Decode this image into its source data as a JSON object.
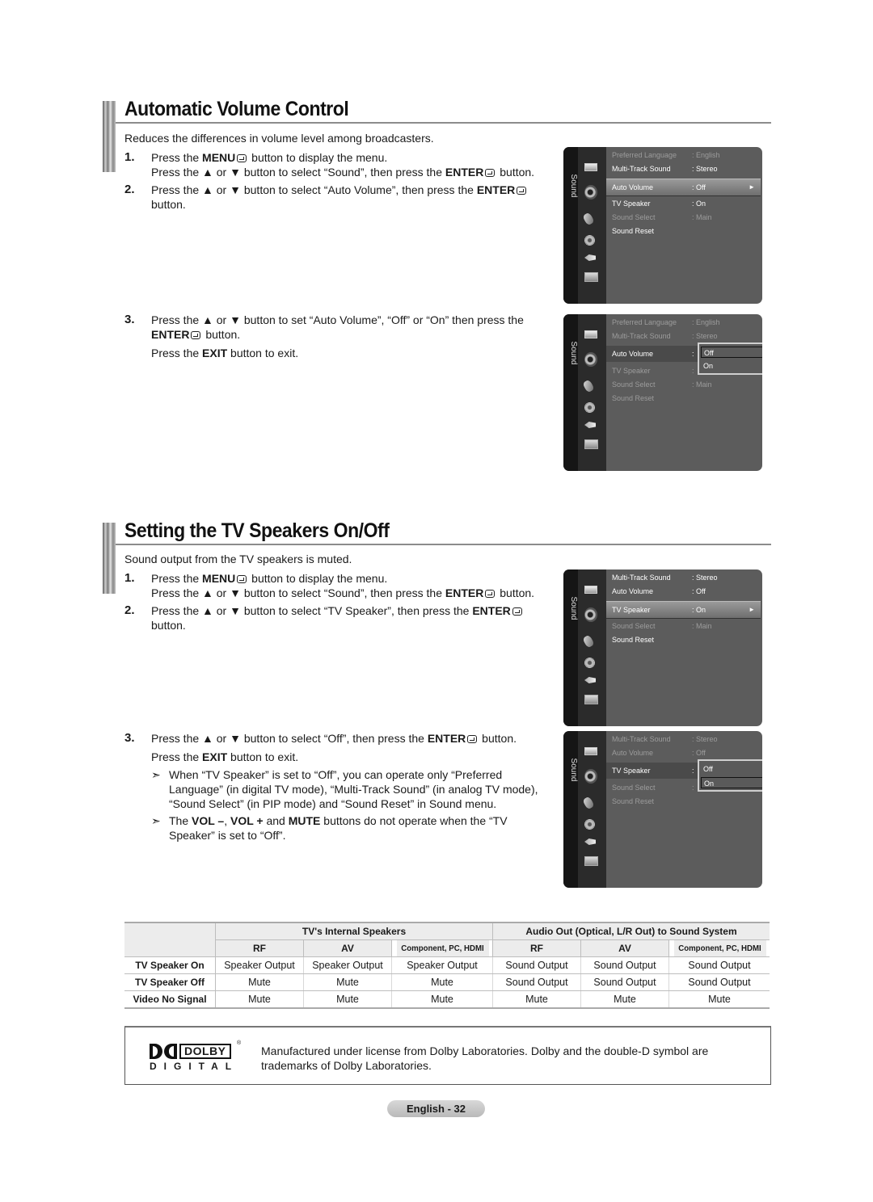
{
  "sections": [
    {
      "title": "Automatic Volume Control",
      "intro": "Reduces the differences in volume level among broadcasters.",
      "steps": [
        {
          "num": "1.",
          "lines": [
            {
              "pre": "Press the ",
              "bold": "MENU",
              "post": " button to display the menu."
            },
            {
              "pre": "Press the ▲ or ▼ button to select “Sound”, then press the ",
              "bold": "ENTER",
              "post": " button."
            }
          ]
        },
        {
          "num": "2.",
          "lines": [
            {
              "pre": "Press the ▲ or ▼ button to select “Auto Volume”, then press the ",
              "bold": "ENTER",
              "post": ""
            },
            {
              "pre": "button.",
              "bold": "",
              "post": ""
            }
          ]
        },
        {
          "num": "3.",
          "lines": [
            {
              "pre": "Press the ▲ or ▼ button to set “Auto Volume”, “Off” or “On” then press the",
              "bold": "",
              "post": ""
            },
            {
              "pre": "",
              "bold": "ENTER",
              "post": " button."
            }
          ],
          "extra": {
            "pre": "Press the ",
            "bold": "EXIT",
            "post": " button to exit."
          }
        }
      ]
    },
    {
      "title": "Setting the TV Speakers On/Off",
      "intro": "Sound output from the TV speakers is muted.",
      "steps": [
        {
          "num": "1.",
          "lines": [
            {
              "pre": "Press the ",
              "bold": "MENU",
              "post": " button to display the menu."
            },
            {
              "pre": "Press the ▲ or ▼ button to select “Sound”, then press the ",
              "bold": "ENTER",
              "post": " button."
            }
          ]
        },
        {
          "num": "2.",
          "lines": [
            {
              "pre": "Press the ▲ or ▼ button to select “TV Speaker”, then press the ",
              "bold": "ENTER",
              "post": ""
            },
            {
              "pre": "button.",
              "bold": "",
              "post": ""
            }
          ]
        },
        {
          "num": "3.",
          "lines": [
            {
              "pre": "Press the ▲ or ▼ button to select “Off”, then press the ",
              "bold": "ENTER",
              "post": " button."
            }
          ],
          "extra": {
            "pre": "Press the ",
            "bold": "EXIT",
            "post": " button to exit."
          }
        }
      ],
      "notes": [
        {
          "arrow": "➣",
          "lines": [
            "When “TV Speaker” is set to “Off”, you can operate only “Preferred",
            "Language” (in digital TV mode), “Multi-Track Sound” (in analog TV mode),",
            "“Sound Select” (in PIP mode) and “Sound Reset” in Sound menu."
          ]
        },
        {
          "arrow": "➣",
          "lines_rich": [
            [
              {
                "t": "The "
              },
              {
                "b": "VOL –"
              },
              {
                "t": ", "
              },
              {
                "b": "VOL +"
              },
              {
                "t": " and "
              },
              {
                "b": "MUTE"
              },
              {
                "t": " buttons do not operate when the “TV"
              }
            ],
            [
              {
                "t": "Speaker” is set to “Off”."
              }
            ]
          ]
        }
      ]
    }
  ],
  "osd": {
    "side_label": "Sound",
    "icons": [
      "picture-icon",
      "sound-icon",
      "channel-icon",
      "setup-icon",
      "input-icon",
      "application-icon"
    ],
    "screens": [
      {
        "rows": [
          {
            "label": "Preferred Language",
            "value": ": English",
            "state": "dim"
          },
          {
            "label": "Multi-Track Sound",
            "value": ": Stereo",
            "state": "normal"
          },
          {
            "label": "Auto Volume",
            "value": ": Off",
            "state": "selected"
          },
          {
            "label": "TV Speaker",
            "value": ": On",
            "state": "normal"
          },
          {
            "label": "Sound Select",
            "value": ": Main",
            "state": "dim"
          },
          {
            "label": "Sound Reset",
            "value": "",
            "state": "normal"
          }
        ]
      },
      {
        "rows": [
          {
            "label": "Preferred Language",
            "value": ": English",
            "state": "dim"
          },
          {
            "label": "Multi-Track Sound",
            "value": ": Stereo",
            "state": "dim"
          },
          {
            "label": "Auto Volume",
            "value": ":",
            "state": "open"
          },
          {
            "label": "TV Speaker",
            "value": ":",
            "state": "dim"
          },
          {
            "label": "Sound Select",
            "value": ": Main",
            "state": "dim"
          },
          {
            "label": "Sound Reset",
            "value": "",
            "state": "dim"
          }
        ],
        "popup": {
          "options": [
            "Off",
            "On"
          ],
          "current": "Off"
        }
      },
      {
        "rows": [
          {
            "label": "Multi-Track Sound",
            "value": ": Stereo",
            "state": "normal"
          },
          {
            "label": "Auto Volume",
            "value": ": Off",
            "state": "normal"
          },
          {
            "label": "TV Speaker",
            "value": ": On",
            "state": "selected"
          },
          {
            "label": "Sound Select",
            "value": ": Main",
            "state": "dim"
          },
          {
            "label": "Sound Reset",
            "value": "",
            "state": "normal"
          }
        ]
      },
      {
        "rows": [
          {
            "label": "Multi-Track Sound",
            "value": ": Stereo",
            "state": "dim"
          },
          {
            "label": "Auto Volume",
            "value": ": Off",
            "state": "dim"
          },
          {
            "label": "TV Speaker",
            "value": ":",
            "state": "open"
          },
          {
            "label": "Sound Select",
            "value": ":",
            "state": "dim"
          },
          {
            "label": "Sound Reset",
            "value": "",
            "state": "dim"
          }
        ],
        "popup": {
          "options": [
            "Off",
            "On"
          ],
          "current": "On"
        }
      }
    ]
  },
  "table": {
    "group_headers": [
      "TV's Internal Speakers",
      "Audio Out (Optical, L/R Out) to Sound System"
    ],
    "sub_headers": [
      "RF",
      "AV",
      "Component, PC, HDMI",
      "RF",
      "AV",
      "Component, PC, HDMI"
    ],
    "rows": [
      {
        "label": "TV Speaker On",
        "cells": [
          "Speaker Output",
          "Speaker Output",
          "Speaker Output",
          "Sound Output",
          "Sound Output",
          "Sound Output"
        ]
      },
      {
        "label": "TV Speaker Off",
        "cells": [
          "Mute",
          "Mute",
          "Mute",
          "Sound Output",
          "Sound Output",
          "Sound Output"
        ]
      },
      {
        "label": "Video No Signal",
        "cells": [
          "Mute",
          "Mute",
          "Mute",
          "Mute",
          "Mute",
          "Mute"
        ]
      }
    ]
  },
  "dolby": {
    "logo_word": "DOLBY",
    "logo_sub": "DIGITAL",
    "registered": "®",
    "text_lines": [
      "Manufactured under license from Dolby Laboratories. Dolby and the double-D symbol are",
      "trademarks of Dolby Laboratories."
    ]
  },
  "footer": {
    "page_label": "English - 32"
  }
}
